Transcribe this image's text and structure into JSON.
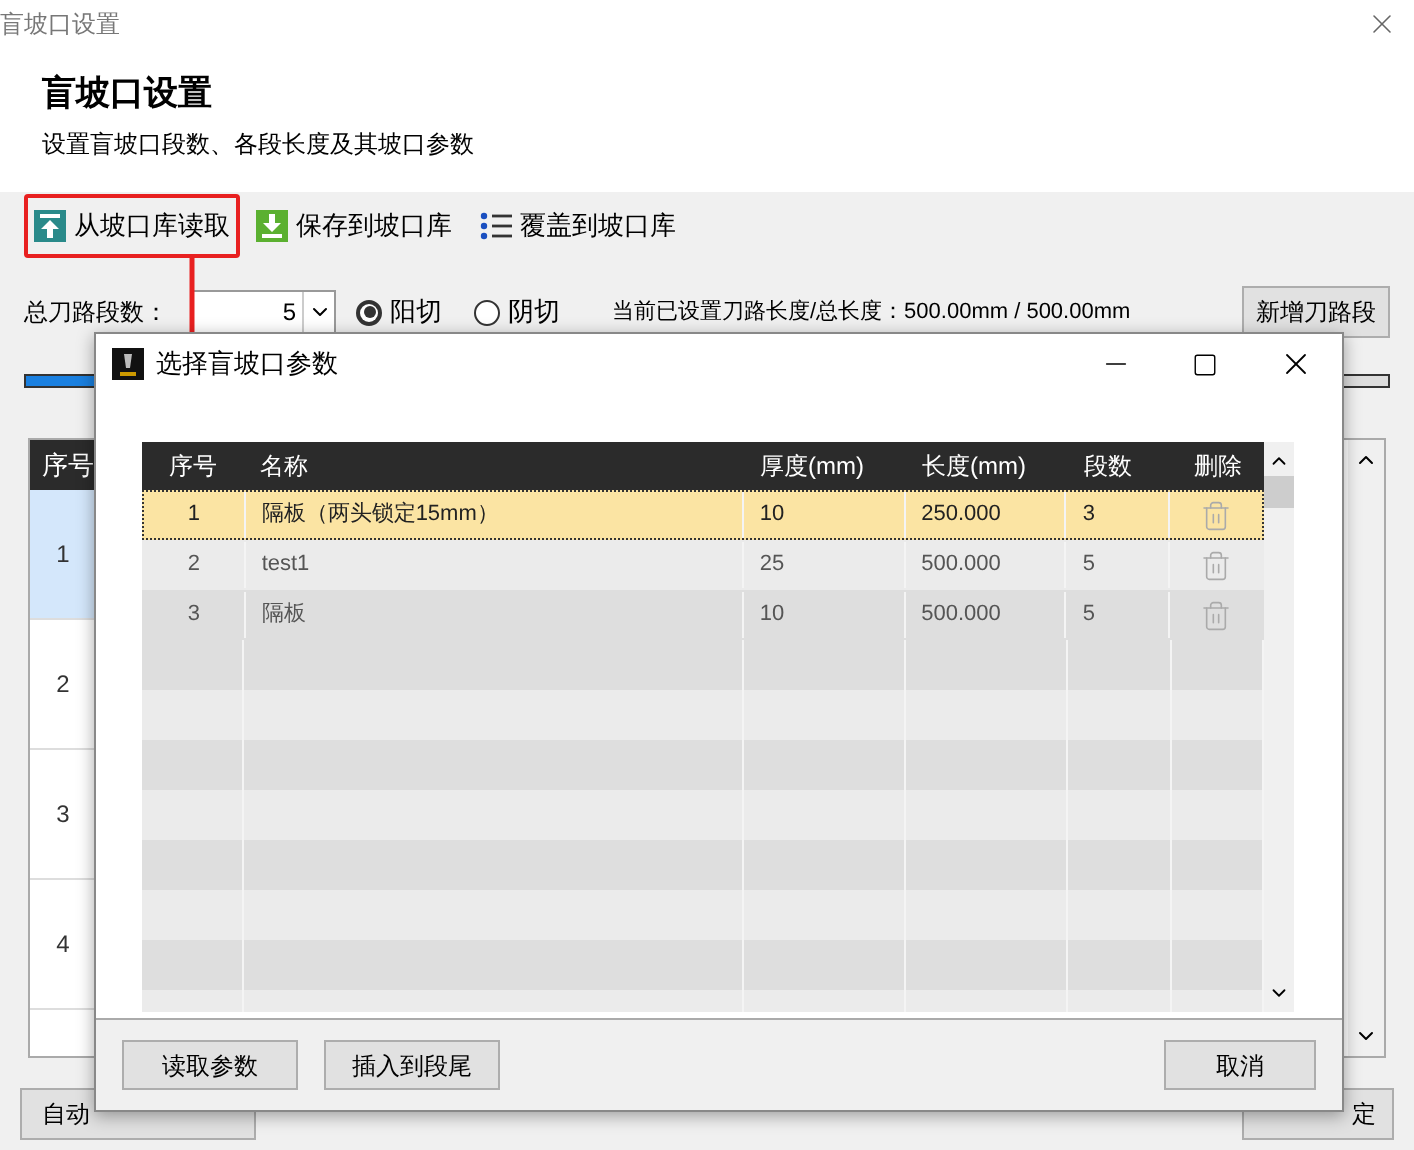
{
  "window": {
    "title": "盲坡口设置"
  },
  "header": {
    "title": "盲坡口设置",
    "subtitle": "设置盲坡口段数、各段长度及其坡口参数"
  },
  "toolbar": [
    {
      "label": "从坡口库读取",
      "kind": "load",
      "highlighted": true
    },
    {
      "label": "保存到坡口库",
      "kind": "save",
      "highlighted": false
    },
    {
      "label": "覆盖到坡口库",
      "kind": "list",
      "highlighted": false
    }
  ],
  "segments": {
    "label": "总刀路段数：",
    "value": "5"
  },
  "cut_type": [
    {
      "label": "阳切",
      "selected": true
    },
    {
      "label": "阴切",
      "selected": false
    }
  ],
  "length_info": "当前已设置刀路长度/总长度：500.00mm / 500.00mm",
  "add_button": "新增刀路段",
  "progress": {
    "level": 0.05
  },
  "segment_table": {
    "column": "序号",
    "rows": [
      {
        "index": "1",
        "selected": true
      },
      {
        "index": "2",
        "selected": false
      },
      {
        "index": "3",
        "selected": false
      },
      {
        "index": "4",
        "selected": false
      }
    ]
  },
  "footer_buttons": [
    "自动",
    "定"
  ],
  "dialog": {
    "title": "选择盲坡口参数",
    "columns": [
      "序号",
      "名称",
      "厚度(mm)",
      "长度(mm)",
      "段数",
      "删除"
    ],
    "rows": [
      {
        "cells": [
          "1",
          "隔板（两头锁定15mm）",
          "10",
          "250.000",
          "3"
        ],
        "selected": true
      },
      {
        "cells": [
          "2",
          "test1",
          "25",
          "500.000",
          "5"
        ],
        "selected": false
      },
      {
        "cells": [
          "3",
          "隔板",
          "10",
          "500.000",
          "5"
        ],
        "selected": false
      }
    ],
    "left_buttons": [
      "读取参数",
      "插入到段尾"
    ],
    "right_button": "取消"
  }
}
